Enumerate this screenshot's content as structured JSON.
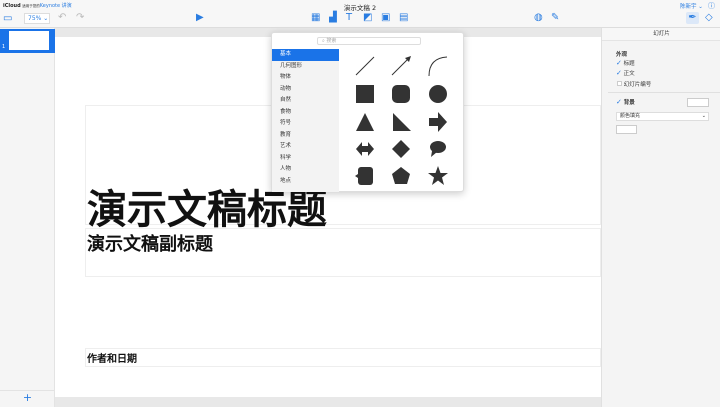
{
  "header": {
    "brand_icloud": "iCloud",
    "brand_sub": "适用于您的",
    "brand_app": "Keynote 讲演",
    "doc_title": "演示文稿 2",
    "zoom": "75%",
    "user": "陈新宇"
  },
  "sidebar": {
    "slide_number": "1"
  },
  "slide": {
    "title": "演示文稿标题",
    "subtitle": "演示文稿副标题",
    "author": "作者和日期"
  },
  "popover": {
    "search_placeholder": "搜索",
    "categories": [
      "基本",
      "几何图形",
      "物体",
      "动物",
      "自然",
      "食物",
      "符号",
      "教育",
      "艺术",
      "科学",
      "人物",
      "地点"
    ],
    "selected": "基本"
  },
  "panel": {
    "header": "幻灯片",
    "appearance": "外观",
    "title_opt": "标题",
    "body_opt": "正文",
    "slide_number_opt": "幻灯片编号",
    "background": "背景",
    "fill_type": "颜色填充"
  },
  "colors": {
    "accent": "#1a73e8"
  }
}
